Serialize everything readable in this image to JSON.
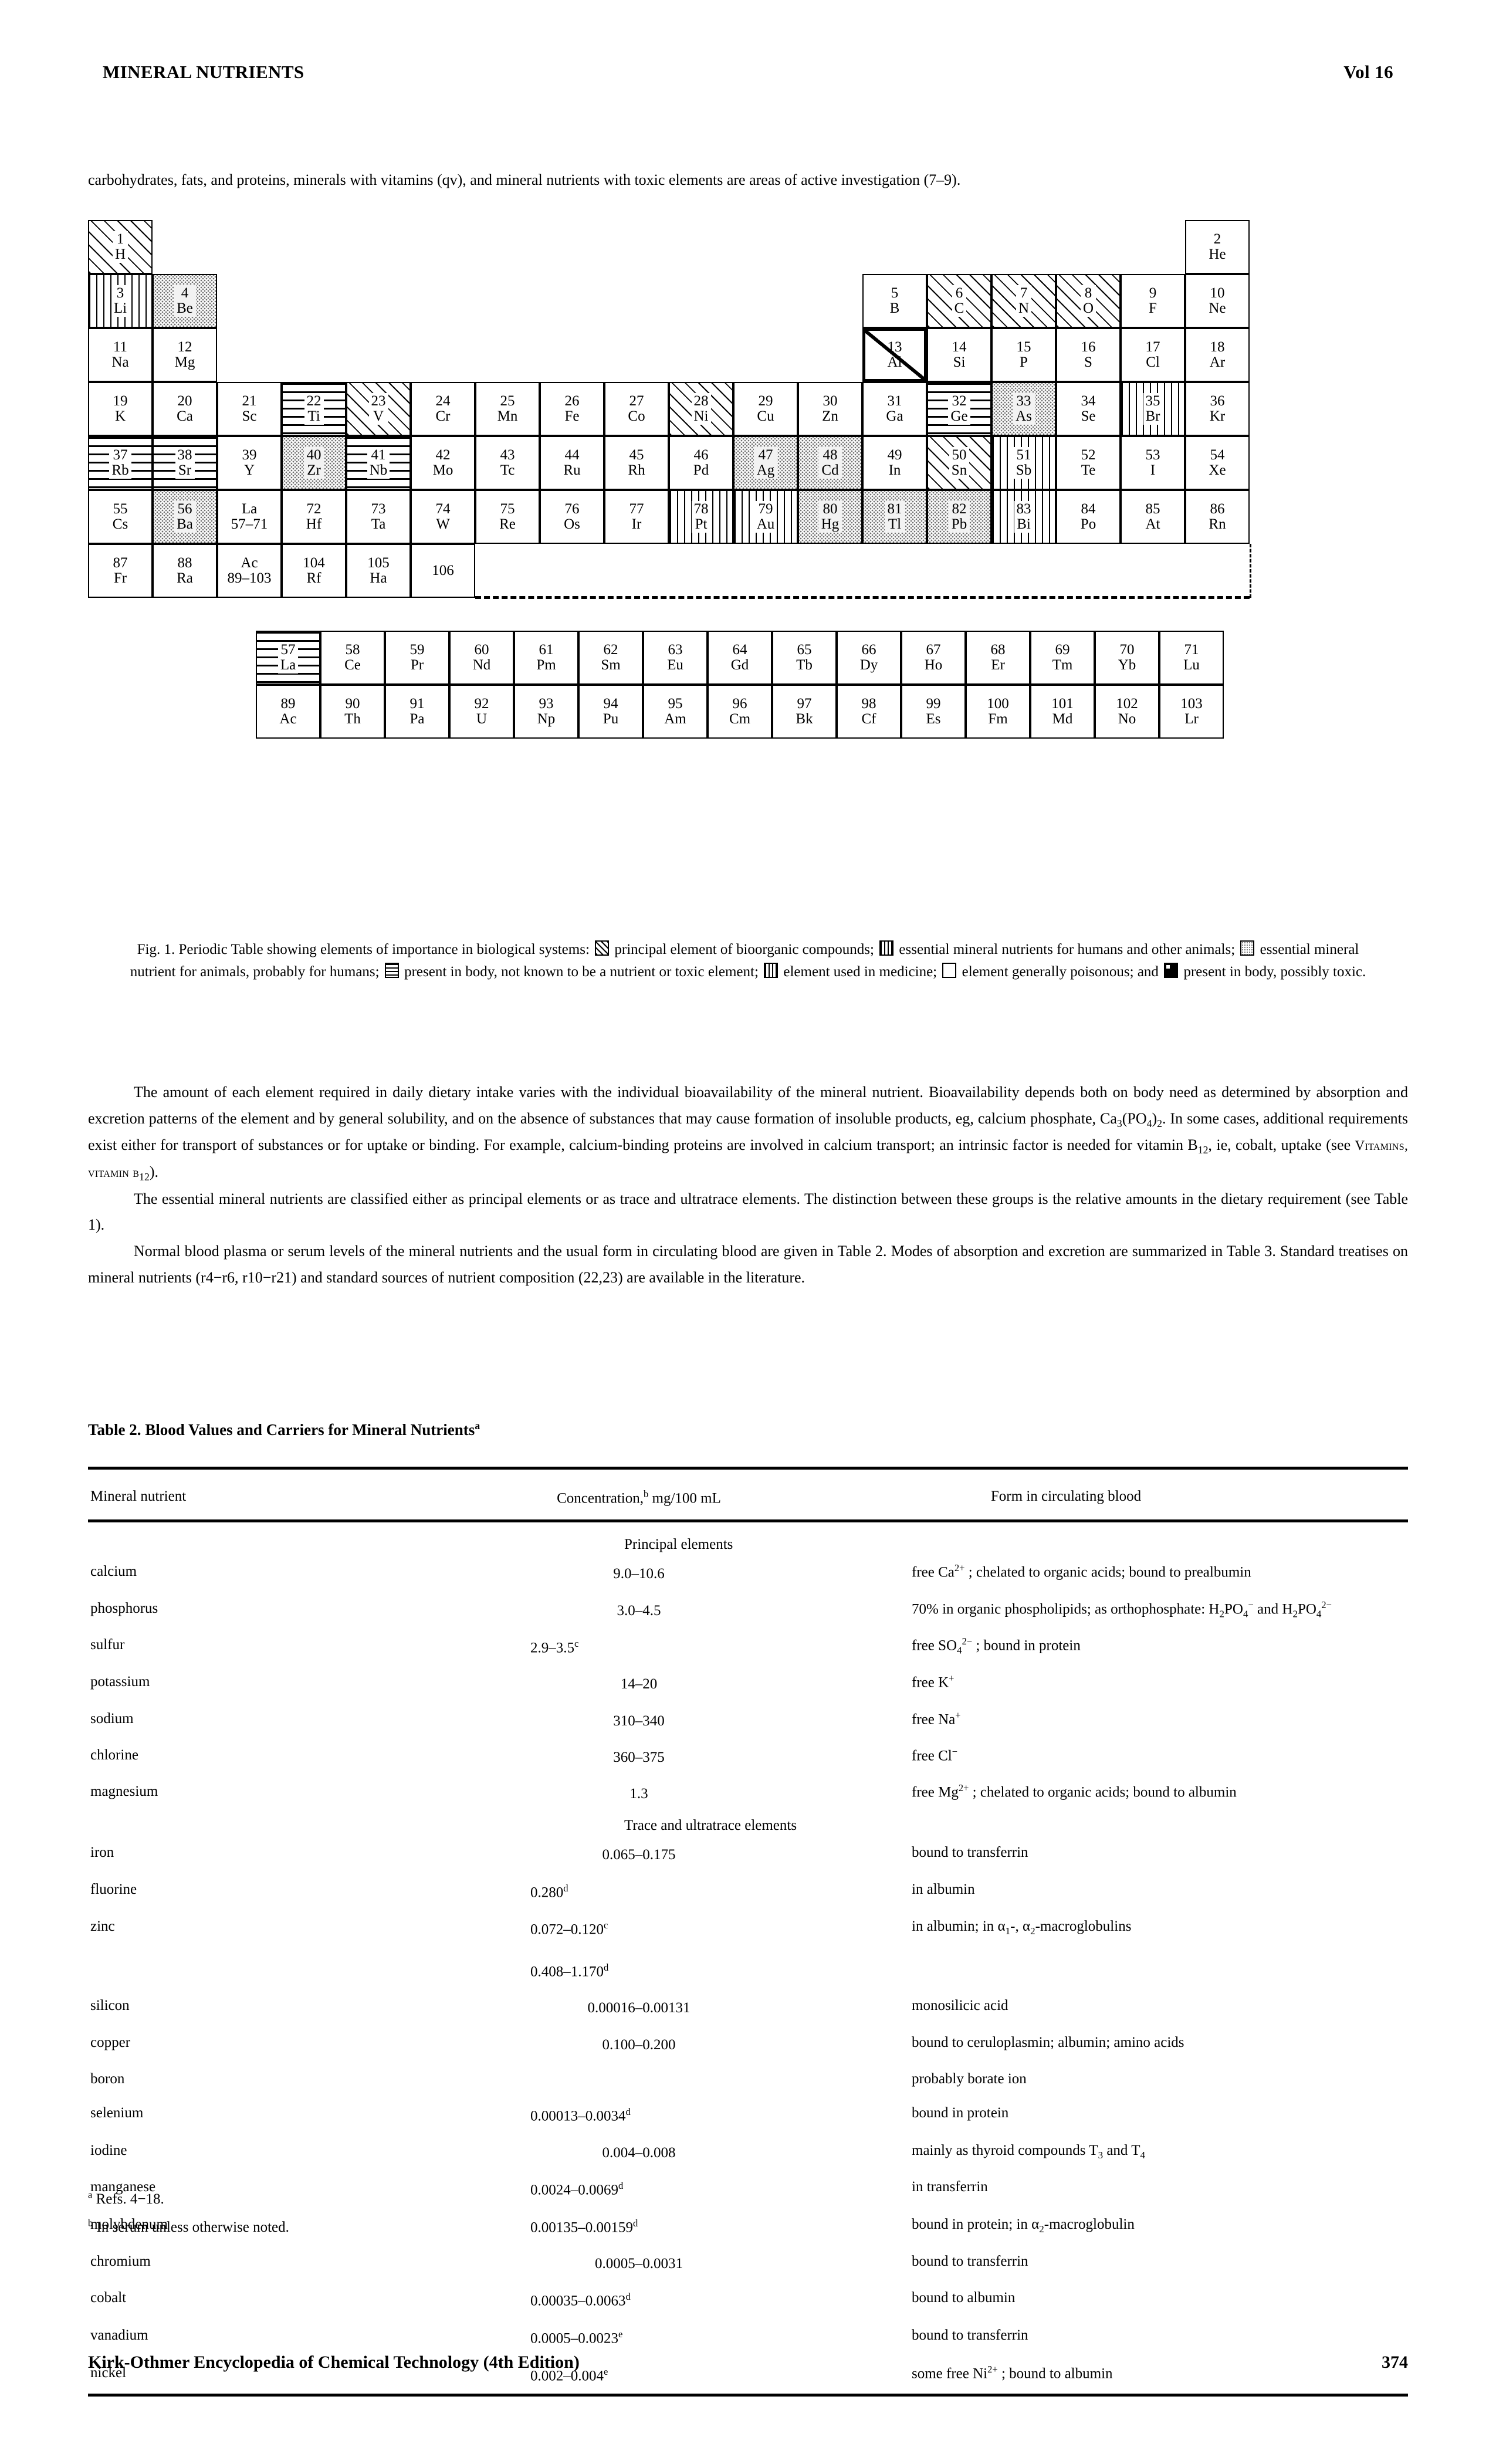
{
  "runhead": {
    "title": "MINERAL NUTRIENTS",
    "volume": "Vol 16"
  },
  "intro": "carbohydrates, fats, and proteins, minerals with vitamins (qv), and mineral nutrients with toxic elements are areas of active investigation (7–9).",
  "periodic_table": {
    "legend_patterns": {
      "diagonal": "principal element of bioorganic compounds",
      "crosshatch": "essential mineral nutrients for humans and other animals",
      "dotted": "essential mineral nutrient for animals, probably for humans",
      "horizontal": "present in body, not known to be a nutrient or toxic element",
      "vertical": "element used in medicine",
      "open": "element generally poisonous",
      "black": "present in body, possibly toxic"
    },
    "elements": [
      {
        "z": "1",
        "sym": "H",
        "fill": "diag",
        "row": 1,
        "col": 1
      },
      {
        "z": "2",
        "sym": "He",
        "fill": "none",
        "row": 1,
        "col": 18
      },
      {
        "z": "3",
        "sym": "Li",
        "fill": "vert",
        "row": 2,
        "col": 1
      },
      {
        "z": "4",
        "sym": "Be",
        "fill": "dot",
        "row": 2,
        "col": 2
      },
      {
        "z": "5",
        "sym": "B",
        "fill": "none",
        "row": 2,
        "col": 13
      },
      {
        "z": "6",
        "sym": "C",
        "fill": "diag",
        "row": 2,
        "col": 14
      },
      {
        "z": "7",
        "sym": "N",
        "fill": "diag",
        "row": 2,
        "col": 15
      },
      {
        "z": "8",
        "sym": "O",
        "fill": "diag",
        "row": 2,
        "col": 16
      },
      {
        "z": "9",
        "sym": "F",
        "fill": "none",
        "row": 2,
        "col": 17
      },
      {
        "z": "10",
        "sym": "Ne",
        "fill": "none",
        "row": 2,
        "col": 18
      },
      {
        "z": "11",
        "sym": "Na",
        "fill": "none",
        "row": 3,
        "col": 1
      },
      {
        "z": "12",
        "sym": "Mg",
        "fill": "none",
        "row": 3,
        "col": 2
      },
      {
        "z": "13",
        "sym": "Al",
        "fill": "black",
        "row": 3,
        "col": 13
      },
      {
        "z": "14",
        "sym": "Si",
        "fill": "none",
        "row": 3,
        "col": 14
      },
      {
        "z": "15",
        "sym": "P",
        "fill": "none",
        "row": 3,
        "col": 15
      },
      {
        "z": "16",
        "sym": "S",
        "fill": "none",
        "row": 3,
        "col": 16
      },
      {
        "z": "17",
        "sym": "Cl",
        "fill": "none",
        "row": 3,
        "col": 17
      },
      {
        "z": "18",
        "sym": "Ar",
        "fill": "none",
        "row": 3,
        "col": 18
      },
      {
        "z": "19",
        "sym": "K",
        "fill": "none",
        "row": 4,
        "col": 1
      },
      {
        "z": "20",
        "sym": "Ca",
        "fill": "none",
        "row": 4,
        "col": 2
      },
      {
        "z": "21",
        "sym": "Sc",
        "fill": "none",
        "row": 4,
        "col": 3
      },
      {
        "z": "22",
        "sym": "Ti",
        "fill": "horz",
        "row": 4,
        "col": 4
      },
      {
        "z": "23",
        "sym": "V",
        "fill": "diag",
        "row": 4,
        "col": 5
      },
      {
        "z": "24",
        "sym": "Cr",
        "fill": "none",
        "row": 4,
        "col": 6
      },
      {
        "z": "25",
        "sym": "Mn",
        "fill": "none",
        "row": 4,
        "col": 7
      },
      {
        "z": "26",
        "sym": "Fe",
        "fill": "none",
        "row": 4,
        "col": 8
      },
      {
        "z": "27",
        "sym": "Co",
        "fill": "none",
        "row": 4,
        "col": 9
      },
      {
        "z": "28",
        "sym": "Ni",
        "fill": "diag",
        "row": 4,
        "col": 10
      },
      {
        "z": "29",
        "sym": "Cu",
        "fill": "none",
        "row": 4,
        "col": 11
      },
      {
        "z": "30",
        "sym": "Zn",
        "fill": "none",
        "row": 4,
        "col": 12
      },
      {
        "z": "31",
        "sym": "Ga",
        "fill": "none",
        "row": 4,
        "col": 13
      },
      {
        "z": "32",
        "sym": "Ge",
        "fill": "horz",
        "row": 4,
        "col": 14
      },
      {
        "z": "33",
        "sym": "As",
        "fill": "dot",
        "row": 4,
        "col": 15
      },
      {
        "z": "34",
        "sym": "Se",
        "fill": "none",
        "row": 4,
        "col": 16
      },
      {
        "z": "35",
        "sym": "Br",
        "fill": "vert",
        "row": 4,
        "col": 17
      },
      {
        "z": "36",
        "sym": "Kr",
        "fill": "none",
        "row": 4,
        "col": 18
      },
      {
        "z": "37",
        "sym": "Rb",
        "fill": "horz",
        "row": 5,
        "col": 1
      },
      {
        "z": "38",
        "sym": "Sr",
        "fill": "horz",
        "row": 5,
        "col": 2
      },
      {
        "z": "39",
        "sym": "Y",
        "fill": "none",
        "row": 5,
        "col": 3
      },
      {
        "z": "40",
        "sym": "Zr",
        "fill": "dot",
        "row": 5,
        "col": 4
      },
      {
        "z": "41",
        "sym": "Nb",
        "fill": "horz",
        "row": 5,
        "col": 5
      },
      {
        "z": "42",
        "sym": "Mo",
        "fill": "none",
        "row": 5,
        "col": 6
      },
      {
        "z": "43",
        "sym": "Tc",
        "fill": "none",
        "row": 5,
        "col": 7
      },
      {
        "z": "44",
        "sym": "Ru",
        "fill": "none",
        "row": 5,
        "col": 8
      },
      {
        "z": "45",
        "sym": "Rh",
        "fill": "none",
        "row": 5,
        "col": 9
      },
      {
        "z": "46",
        "sym": "Pd",
        "fill": "none",
        "row": 5,
        "col": 10
      },
      {
        "z": "47",
        "sym": "Ag",
        "fill": "dot",
        "row": 5,
        "col": 11
      },
      {
        "z": "48",
        "sym": "Cd",
        "fill": "dot",
        "row": 5,
        "col": 12
      },
      {
        "z": "49",
        "sym": "In",
        "fill": "none",
        "row": 5,
        "col": 13
      },
      {
        "z": "50",
        "sym": "Sn",
        "fill": "diag",
        "row": 5,
        "col": 14
      },
      {
        "z": "51",
        "sym": "Sb",
        "fill": "vert",
        "row": 5,
        "col": 15
      },
      {
        "z": "52",
        "sym": "Te",
        "fill": "none",
        "row": 5,
        "col": 16
      },
      {
        "z": "53",
        "sym": "I",
        "fill": "none",
        "row": 5,
        "col": 17
      },
      {
        "z": "54",
        "sym": "Xe",
        "fill": "none",
        "row": 5,
        "col": 18
      },
      {
        "z": "55",
        "sym": "Cs",
        "fill": "none",
        "row": 6,
        "col": 1
      },
      {
        "z": "56",
        "sym": "Ba",
        "fill": "dot",
        "row": 6,
        "col": 2
      },
      {
        "z": "La",
        "sym": "57–71",
        "fill": "none",
        "row": 6,
        "col": 3
      },
      {
        "z": "72",
        "sym": "Hf",
        "fill": "none",
        "row": 6,
        "col": 4
      },
      {
        "z": "73",
        "sym": "Ta",
        "fill": "none",
        "row": 6,
        "col": 5
      },
      {
        "z": "74",
        "sym": "W",
        "fill": "none",
        "row": 6,
        "col": 6
      },
      {
        "z": "75",
        "sym": "Re",
        "fill": "none",
        "row": 6,
        "col": 7
      },
      {
        "z": "76",
        "sym": "Os",
        "fill": "none",
        "row": 6,
        "col": 8
      },
      {
        "z": "77",
        "sym": "Ir",
        "fill": "none",
        "row": 6,
        "col": 9
      },
      {
        "z": "78",
        "sym": "Pt",
        "fill": "vert",
        "row": 6,
        "col": 10
      },
      {
        "z": "79",
        "sym": "Au",
        "fill": "vert",
        "row": 6,
        "col": 11
      },
      {
        "z": "80",
        "sym": "Hg",
        "fill": "dot",
        "row": 6,
        "col": 12
      },
      {
        "z": "81",
        "sym": "Tl",
        "fill": "dot",
        "row": 6,
        "col": 13
      },
      {
        "z": "82",
        "sym": "Pb",
        "fill": "dot",
        "row": 6,
        "col": 14
      },
      {
        "z": "83",
        "sym": "Bi",
        "fill": "vert",
        "row": 6,
        "col": 15
      },
      {
        "z": "84",
        "sym": "Po",
        "fill": "none",
        "row": 6,
        "col": 16
      },
      {
        "z": "85",
        "sym": "At",
        "fill": "none",
        "row": 6,
        "col": 17
      },
      {
        "z": "86",
        "sym": "Rn",
        "fill": "none",
        "row": 6,
        "col": 18
      },
      {
        "z": "87",
        "sym": "Fr",
        "fill": "none",
        "row": 7,
        "col": 1
      },
      {
        "z": "88",
        "sym": "Ra",
        "fill": "none",
        "row": 7,
        "col": 2
      },
      {
        "z": "Ac",
        "sym": "89–103",
        "fill": "none",
        "row": 7,
        "col": 3
      },
      {
        "z": "104",
        "sym": "Rf",
        "fill": "none",
        "row": 7,
        "col": 4
      },
      {
        "z": "105",
        "sym": "Ha",
        "fill": "none",
        "row": 7,
        "col": 5
      },
      {
        "z": "106",
        "sym": "",
        "fill": "none",
        "row": 7,
        "col": 6
      }
    ],
    "lanthanides": [
      {
        "z": "57",
        "sym": "La",
        "fill": "horz"
      },
      {
        "z": "58",
        "sym": "Ce",
        "fill": "none"
      },
      {
        "z": "59",
        "sym": "Pr",
        "fill": "none"
      },
      {
        "z": "60",
        "sym": "Nd",
        "fill": "none"
      },
      {
        "z": "61",
        "sym": "Pm",
        "fill": "none"
      },
      {
        "z": "62",
        "sym": "Sm",
        "fill": "none"
      },
      {
        "z": "63",
        "sym": "Eu",
        "fill": "none"
      },
      {
        "z": "64",
        "sym": "Gd",
        "fill": "none"
      },
      {
        "z": "65",
        "sym": "Tb",
        "fill": "none"
      },
      {
        "z": "66",
        "sym": "Dy",
        "fill": "none"
      },
      {
        "z": "67",
        "sym": "Ho",
        "fill": "none"
      },
      {
        "z": "68",
        "sym": "Er",
        "fill": "none"
      },
      {
        "z": "69",
        "sym": "Tm",
        "fill": "none"
      },
      {
        "z": "70",
        "sym": "Yb",
        "fill": "none"
      },
      {
        "z": "71",
        "sym": "Lu",
        "fill": "none"
      }
    ],
    "actinides": [
      {
        "z": "89",
        "sym": "Ac",
        "fill": "none"
      },
      {
        "z": "90",
        "sym": "Th",
        "fill": "none"
      },
      {
        "z": "91",
        "sym": "Pa",
        "fill": "none"
      },
      {
        "z": "92",
        "sym": "U",
        "fill": "none"
      },
      {
        "z": "93",
        "sym": "Np",
        "fill": "none"
      },
      {
        "z": "94",
        "sym": "Pu",
        "fill": "none"
      },
      {
        "z": "95",
        "sym": "Am",
        "fill": "none"
      },
      {
        "z": "96",
        "sym": "Cm",
        "fill": "none"
      },
      {
        "z": "97",
        "sym": "Bk",
        "fill": "none"
      },
      {
        "z": "98",
        "sym": "Cf",
        "fill": "none"
      },
      {
        "z": "99",
        "sym": "Es",
        "fill": "none"
      },
      {
        "z": "100",
        "sym": "Fm",
        "fill": "none"
      },
      {
        "z": "101",
        "sym": "Md",
        "fill": "none"
      },
      {
        "z": "102",
        "sym": "No",
        "fill": "none"
      },
      {
        "z": "103",
        "sym": "Lr",
        "fill": "none"
      }
    ]
  },
  "figure_caption": {
    "part1": "Fig. 1. Periodic Table showing elements of importance in biological systems:",
    "part2": "principal element of bioorganic compounds;",
    "part3": "essential mineral nutrients for humans and other animals;",
    "part4": "essential mineral nutrient for animals, probably for humans;",
    "part5": "present in body, not known to be a nutrient or toxic element;",
    "part6": "element used in medicine;",
    "part7": "element generally poisonous; and",
    "part8": "present in body, possibly toxic."
  },
  "paragraphs": {
    "p1_a": "The amount of each element required in daily dietary intake varies with the individual bioavailability of the mineral nutrient. Bioavailability depends both on body need as determined by absorption and excretion patterns of the element and by general solubility, and on the absence of substances that may cause formation of insoluble products, eg, calcium phosphate, Ca",
    "p1_sub1": "3",
    "p1_b": "(PO",
    "p1_sub2": "4",
    "p1_c": ")",
    "p1_sub3": "2",
    "p1_d": ". In some cases, additional requirements exist either for transport of substances or for uptake or binding. For example, calcium-binding proteins are involved in calcium transport; an intrinsic factor is needed for vitamin B",
    "p1_sub4": "12",
    "p1_e": ", ie, cobalt, uptake (see ",
    "p1_sc1": "Vitamins, vitamin b",
    "p1_sub5": "12",
    "p1_f": ").",
    "p2": "The essential mineral nutrients are classified either as principal elements or as trace and ultratrace elements. The distinction between these groups is the relative amounts in the dietary requirement (see Table 1).",
    "p3": "Normal blood plasma or serum levels of the mineral nutrients and the usual form in circulating blood are given in Table 2. Modes of absorption and excretion are summarized in Table 3. Standard treatises on mineral nutrients (r4−r6, r10−r21) and standard sources of nutrient composition (22,23) are available in the literature."
  },
  "table2": {
    "title": "Table 2. Blood Values and Carriers for Mineral Nutrients",
    "title_sup": "a",
    "headers": {
      "name": "Mineral nutrient",
      "conc_a": "Concentration,",
      "conc_sup": "b",
      "conc_b": "mg/100 mL",
      "form": "Form in circulating blood"
    },
    "sections": [
      {
        "label": "Principal elements",
        "rows": [
          {
            "name": "calcium",
            "conc": "9.0–10.6",
            "form_html": "free Ca<sup>2+</sup> ; chelated to organic acids; bound to prealbumin"
          },
          {
            "name": "phosphorus",
            "conc": "3.0–4.5",
            "form_html": "70% in organic phospholipids; as orthophosphate: H<sub>2</sub>PO<sub>4</sub><sup>−</sup> and H<sub>2</sub>PO<sub>4</sub><sup>2−</sup>"
          },
          {
            "name": "sulfur",
            "conc": "2.9–3.5",
            "conc_sup": "c",
            "conc_align": "left",
            "form_html": "free SO<sub>4</sub><sup>2−</sup> ; bound in protein"
          },
          {
            "name": "potassium",
            "conc": "14–20",
            "form_html": "free K<sup>+</sup>"
          },
          {
            "name": "sodium",
            "conc": "310–340",
            "form_html": "free Na<sup>+</sup>"
          },
          {
            "name": "chlorine",
            "conc": "360–375",
            "form_html": "free Cl<sup>−</sup>"
          },
          {
            "name": "magnesium",
            "conc": "1.3",
            "form_html": "free Mg<sup>2+</sup> ; chelated to organic acids; bound to albumin"
          }
        ]
      },
      {
        "label": "Trace and ultratrace elements",
        "rows": [
          {
            "name": "iron",
            "conc": "0.065–0.175",
            "form_html": "bound to transferrin"
          },
          {
            "name": "fluorine",
            "conc": "0.280",
            "conc_sup": "d",
            "conc_align": "left",
            "form_html": "in albumin"
          },
          {
            "name": "zinc",
            "conc": "0.072–0.120",
            "conc_sup": "c",
            "conc_align": "left",
            "conc2": "0.408–1.170",
            "conc2_sup": "d",
            "form_html": "in albumin; in α<sub>1</sub>-, α<sub>2</sub>-macroglobulins"
          },
          {
            "name": "silicon",
            "conc": "0.00016–0.00131",
            "form_html": "monosilicic acid"
          },
          {
            "name": "copper",
            "conc": "0.100–0.200",
            "form_html": "bound to ceruloplasmin; albumin; amino acids"
          },
          {
            "name": "boron",
            "conc": "",
            "form_html": "probably borate ion"
          },
          {
            "name": "selenium",
            "conc": "0.00013–0.0034",
            "conc_sup": "d",
            "conc_align": "left",
            "form_html": "bound in protein"
          },
          {
            "name": "iodine",
            "conc": "0.004–0.008",
            "form_html": "mainly as thyroid compounds T<sub>3</sub> and T<sub>4</sub>"
          },
          {
            "name": "manganese",
            "conc": "0.0024–0.0069",
            "conc_sup": "d",
            "conc_align": "left",
            "form_html": "in transferrin"
          },
          {
            "name": "molybdenum",
            "conc": "0.00135–0.00159",
            "conc_sup": "d",
            "conc_align": "left",
            "form_html": "bound in protein; in α<sub>2</sub>-macroglobulin"
          },
          {
            "name": "chromium",
            "conc": "0.0005–0.0031",
            "form_html": "bound to transferrin"
          },
          {
            "name": "cobalt",
            "conc": "0.00035–0.0063",
            "conc_sup": "d",
            "conc_align": "left",
            "form_html": "bound to albumin"
          },
          {
            "name": "vanadium",
            "conc": "0.0005–0.0023",
            "conc_sup": "e",
            "conc_align": "left",
            "form_html": "bound to transferrin"
          },
          {
            "name": "nickel",
            "conc": "0.002–0.004",
            "conc_sup": "e",
            "conc_align": "left",
            "form_html": "some free Ni<sup>2+</sup> ; bound to albumin"
          }
        ]
      }
    ],
    "footnotes": [
      {
        "mark": "a",
        "text": "Refs. 4−18."
      },
      {
        "mark": "b",
        "text": "In serum unless otherwise noted."
      }
    ]
  },
  "footer": {
    "source": "Kirk-Othmer Encyclopedia of Chemical Technology (4th Edition)",
    "page": "374"
  }
}
